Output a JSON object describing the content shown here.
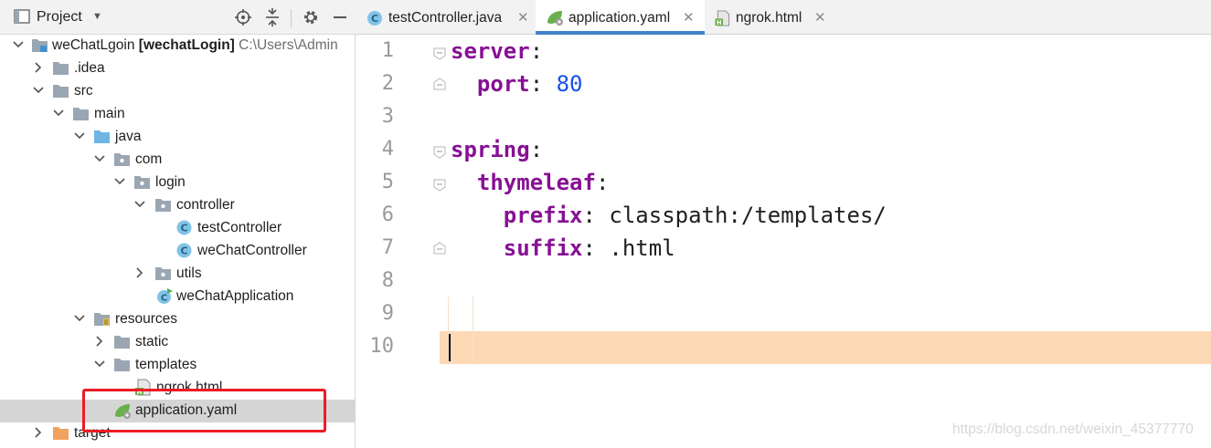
{
  "project_panel": {
    "title": "Project",
    "tree": [
      {
        "label": "weChatLgoin",
        "module": "[wechatLogin]",
        "path": "C:\\Users\\Admin",
        "icon": "module-folder-icon"
      },
      {
        "label": ".idea",
        "icon": "folder-icon"
      },
      {
        "label": "src",
        "icon": "folder-icon"
      },
      {
        "label": "main",
        "icon": "folder-icon"
      },
      {
        "label": "java",
        "icon": "source-folder-icon"
      },
      {
        "label": "com",
        "icon": "package-icon"
      },
      {
        "label": "login",
        "icon": "package-icon"
      },
      {
        "label": "controller",
        "icon": "package-icon"
      },
      {
        "label": "testController",
        "icon": "java-class-icon"
      },
      {
        "label": "weChatController",
        "icon": "java-class-icon"
      },
      {
        "label": "utils",
        "icon": "package-icon"
      },
      {
        "label": "weChatApplication",
        "icon": "spring-boot-class-icon"
      },
      {
        "label": "resources",
        "icon": "resources-folder-icon"
      },
      {
        "label": "static",
        "icon": "folder-icon"
      },
      {
        "label": "templates",
        "icon": "folder-icon"
      },
      {
        "label": "ngrok.html",
        "icon": "html-file-icon"
      },
      {
        "label": "application.yaml",
        "icon": "yaml-file-icon"
      },
      {
        "label": "target",
        "icon": "excluded-folder-icon"
      }
    ]
  },
  "editor": {
    "tabs": [
      {
        "label": "testController.java",
        "icon": "java-class-icon",
        "active": false
      },
      {
        "label": "application.yaml",
        "icon": "yaml-file-icon",
        "active": true
      },
      {
        "label": "ngrok.html",
        "icon": "html-file-icon",
        "active": false
      }
    ],
    "line_numbers": [
      "1",
      "2",
      "3",
      "4",
      "5",
      "6",
      "7",
      "8",
      "9",
      "10"
    ],
    "code": {
      "l1_key": "server",
      "l1_colon": ":",
      "l2_key": "port",
      "l2_colon": ":",
      "l2_value": "80",
      "l4_key": "spring",
      "l4_colon": ":",
      "l5_key": "thymeleaf",
      "l5_colon": ":",
      "l6_key": "prefix",
      "l6_colon": ":",
      "l6_value": "classpath:/templates/",
      "l7_key": "suffix",
      "l7_colon": ":",
      "l7_value": ".html"
    },
    "current_line": "10"
  },
  "watermark": "https://blog.csdn.net/weixin_45377770",
  "colors": {
    "keyword": "#871094",
    "number": "#1750eb",
    "current_line": "#fdd9b5",
    "highlight_box": "#ec1c24",
    "active_tab_underline": "#4083c9"
  }
}
